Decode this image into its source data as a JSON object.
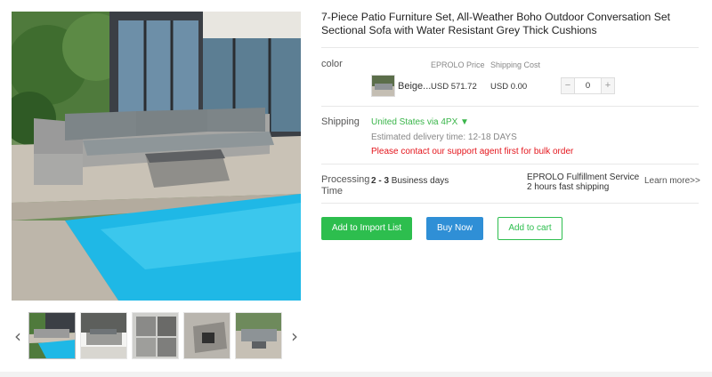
{
  "product": {
    "title": "7-Piece Patio Furniture Set, All-Weather Boho Outdoor Conversation Set Sectional Sofa with Water Resistant Grey Thick Cushions"
  },
  "gallery": {
    "prev_icon": "chevron-left-icon",
    "next_icon": "chevron-right-icon",
    "prev_glyph": "‹",
    "next_glyph": "›",
    "thumbnails": [
      "thumbnail-1",
      "thumbnail-2",
      "thumbnail-3",
      "thumbnail-4",
      "thumbnail-5"
    ]
  },
  "variant": {
    "row_label": "color",
    "price_header": "EPROLO Price",
    "shipping_header": "Shipping Cost",
    "name": "Beige...",
    "price": "USD 571.72",
    "shipping_cost": "USD 0.00",
    "quantity": "0",
    "minus_glyph": "−",
    "plus_glyph": "+"
  },
  "shipping": {
    "row_label": "Shipping",
    "via": "United States via 4PX ▼",
    "estimate": "Estimated delivery time: 12-18 DAYS",
    "warning": "Please contact our support agent first for bulk order"
  },
  "processing": {
    "row_label_line1": "Processing",
    "row_label_line2": "Time",
    "days_bold": "2 - 3",
    "days_rest": " Business days",
    "service_line1": "EPROLO Fulfillment Service",
    "service_line2": "2 hours fast shipping",
    "learn_more": "Learn more>>"
  },
  "actions": {
    "import": "Add to Import List",
    "buy": "Buy Now",
    "cart": "Add to cart"
  },
  "colors": {
    "accent_green": "#2dbe4e",
    "accent_blue": "#2f8fd6",
    "warning_red": "#e4161d",
    "ship_green": "#3ab54a"
  }
}
